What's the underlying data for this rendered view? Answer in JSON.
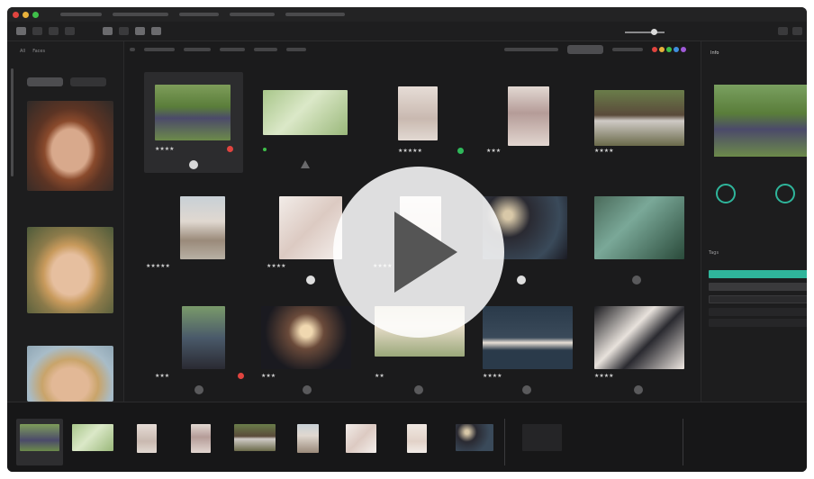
{
  "left_panel": {
    "tabs": [
      "All",
      "Faces"
    ],
    "segments": [
      "",
      ""
    ]
  },
  "grid": {
    "rows": [
      [
        {
          "stars": "★★★★",
          "badge": "red"
        },
        {
          "stars": "",
          "badge": "green-dot"
        },
        {
          "stars": "★★★★★",
          "badge": "green"
        },
        {
          "stars": "★★★",
          "badge": ""
        },
        {
          "stars": "★★★★",
          "badge": ""
        }
      ],
      [
        {
          "stars": "★★★★★",
          "badge": ""
        },
        {
          "stars": "★★★★",
          "badge": ""
        },
        {
          "stars": "★★★★",
          "badge": ""
        },
        {
          "stars": "",
          "badge": ""
        },
        {
          "stars": "",
          "badge": ""
        }
      ],
      [
        {
          "stars": "★★★",
          "badge": "red"
        },
        {
          "stars": "★★★",
          "badge": ""
        },
        {
          "stars": "★★",
          "badge": ""
        },
        {
          "stars": "★★★★",
          "badge": ""
        },
        {
          "stars": "★★★★",
          "badge": ""
        }
      ]
    ]
  },
  "right_panel": {
    "tabs": [
      "Info",
      "",
      ""
    ],
    "tags_label": "Tags"
  },
  "colors": {
    "teal": "#2fb59b",
    "red": "#e0443f",
    "green": "#2fb85a",
    "background": "#1b1b1c"
  },
  "icons": [
    "play-icon",
    "close-dot-icon",
    "minimize-dot-icon",
    "zoom-dot-icon",
    "warning-icon"
  ]
}
